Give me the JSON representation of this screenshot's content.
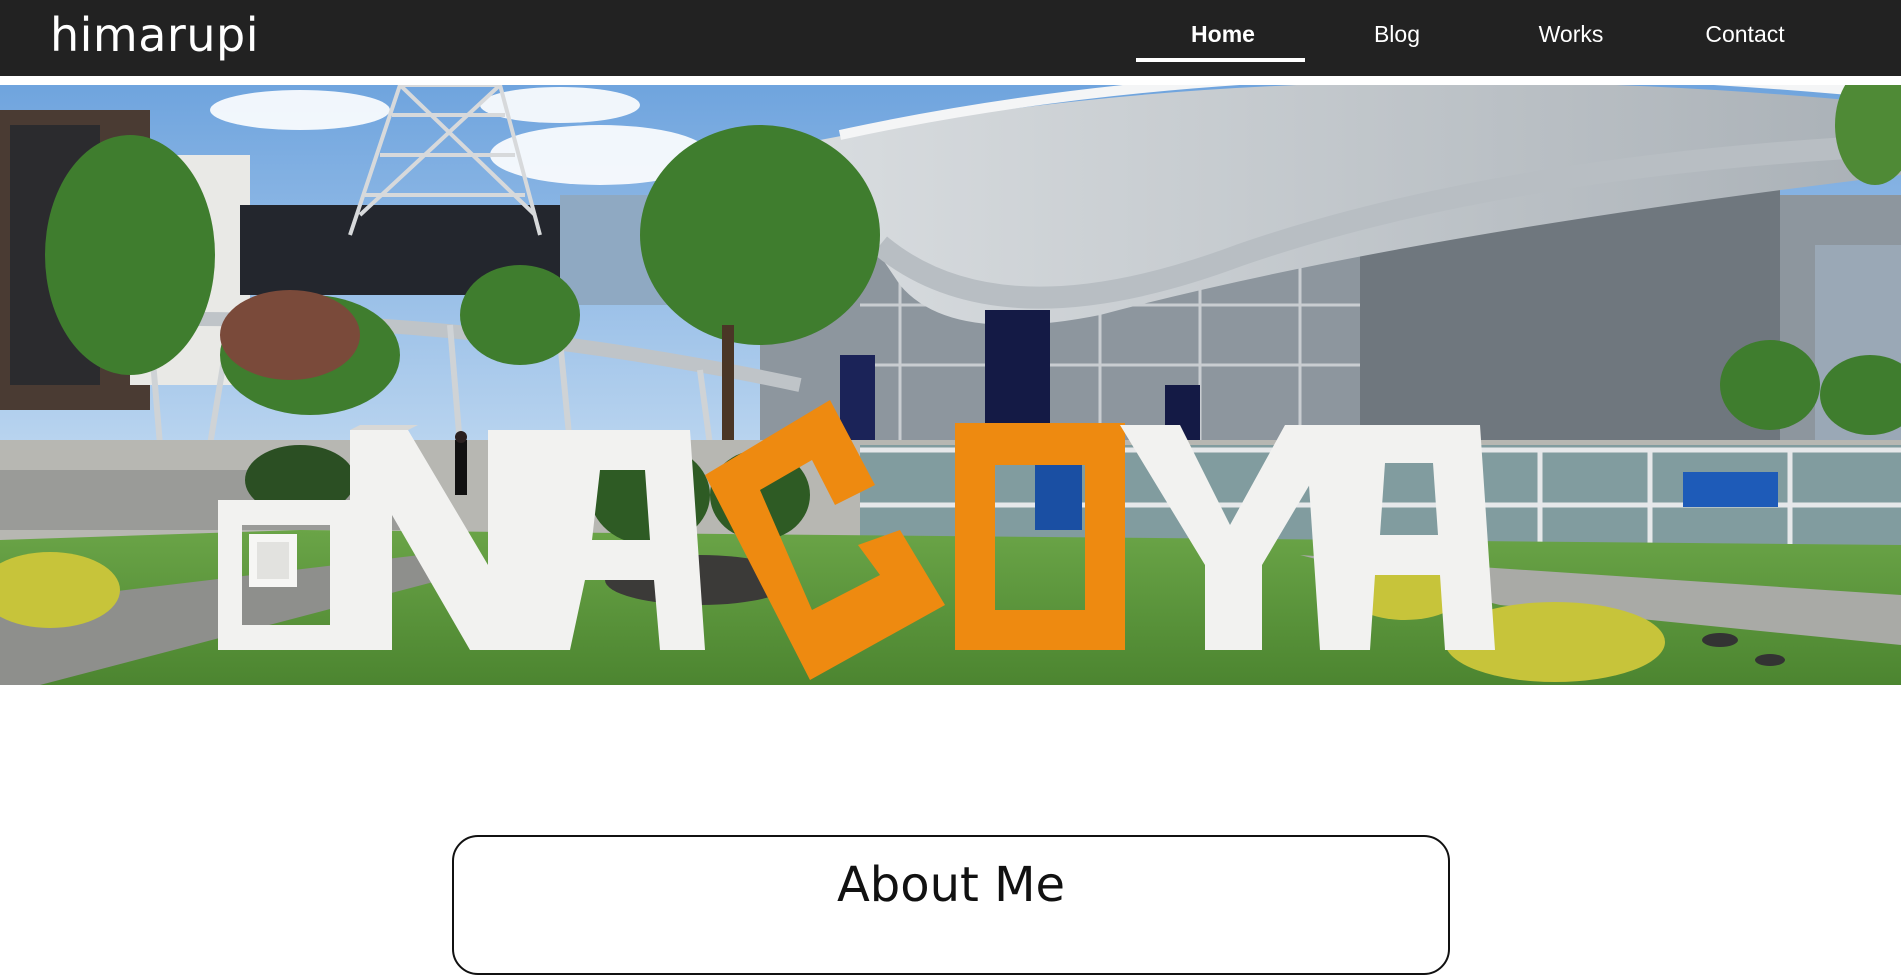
{
  "brand": "himarupi",
  "nav": {
    "items": [
      {
        "label": "Home",
        "active": true
      },
      {
        "label": "Blog",
        "active": false
      },
      {
        "label": "Works",
        "active": false
      },
      {
        "label": "Contact",
        "active": false
      }
    ]
  },
  "hero": {
    "sign_letters": [
      "N",
      "A",
      "G",
      "O",
      "Y",
      "A"
    ],
    "colors": {
      "sky": "#7fb1e6",
      "grass": "#5e9a3a",
      "letter_white": "#f2f2f0",
      "letter_orange": "#ee8a10"
    }
  },
  "about": {
    "title": "About Me"
  },
  "colors": {
    "navbar_bg": "#222222",
    "nav_text": "#ffffff"
  }
}
